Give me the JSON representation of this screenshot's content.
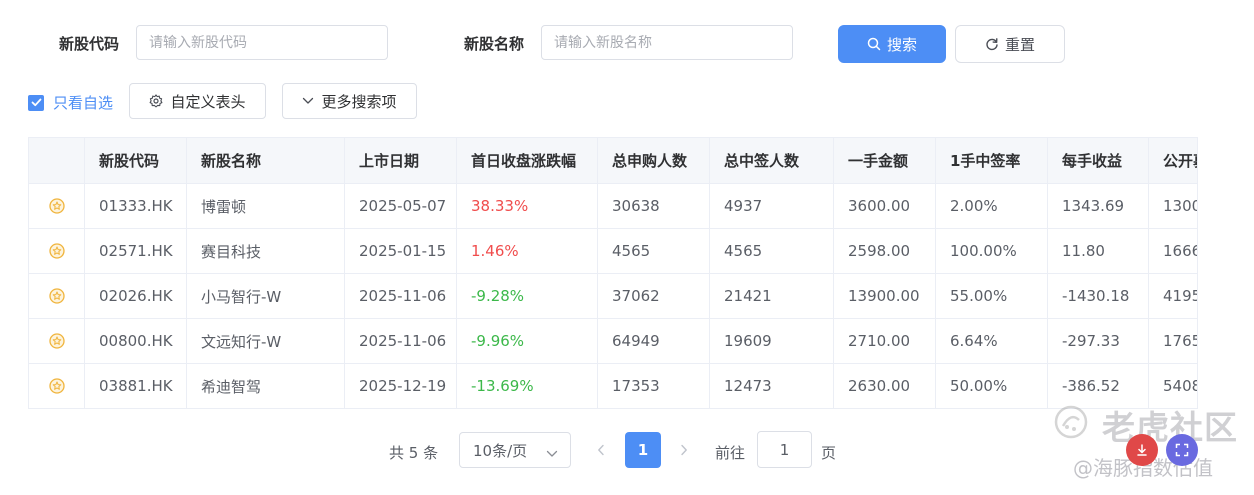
{
  "search": {
    "code_label": "新股代码",
    "code_placeholder": "请输入新股代码",
    "name_label": "新股名称",
    "name_placeholder": "请输入新股名称",
    "search_button": "搜索",
    "reset_button": "重置"
  },
  "toolbar": {
    "only_watchlist": "只看自选",
    "customize_header": "自定义表头",
    "more_search": "更多搜索项"
  },
  "table": {
    "headers": [
      "新股代码",
      "新股名称",
      "上市日期",
      "首日收盘涨跌幅",
      "总申购人数",
      "总中签人数",
      "一手金额",
      "1手中签率",
      "每手收益",
      "公开募"
    ],
    "rows": [
      [
        "01333.HK",
        "博雷顿",
        "2025-05-07",
        "38.33%",
        "30638",
        "4937",
        "3600.00",
        "2.00%",
        "1343.69",
        "1300"
      ],
      [
        "02571.HK",
        "赛目科技",
        "2025-01-15",
        "1.46%",
        "4565",
        "4565",
        "2598.00",
        "100.00%",
        "11.80",
        "1666"
      ],
      [
        "02026.HK",
        "小马智行-W",
        "2025-11-06",
        "-9.28%",
        "37062",
        "21421",
        "13900.00",
        "55.00%",
        "-1430.18",
        "4195"
      ],
      [
        "00800.HK",
        "文远知行-W",
        "2025-11-06",
        "-9.96%",
        "64949",
        "19609",
        "2710.00",
        "6.64%",
        "-297.33",
        "1765"
      ],
      [
        "03881.HK",
        "希迪智驾",
        "2025-12-19",
        "-13.69%",
        "17353",
        "12473",
        "2630.00",
        "50.00%",
        "-386.52",
        "5408"
      ]
    ],
    "change_direction": [
      "up",
      "up",
      "down",
      "down",
      "down"
    ]
  },
  "pagination": {
    "total": "共 5 条",
    "page_size": "10条/页",
    "current_page": "1",
    "goto_label": "前往",
    "goto_value": "1",
    "page_unit": "页"
  },
  "watermark": {
    "brand": "老虎社区",
    "author": "@海豚指数估值"
  },
  "colors": {
    "primary": "#4d8ef5",
    "up": "#f04d4d",
    "down": "#3cb84a",
    "star": "#f0b43c"
  }
}
